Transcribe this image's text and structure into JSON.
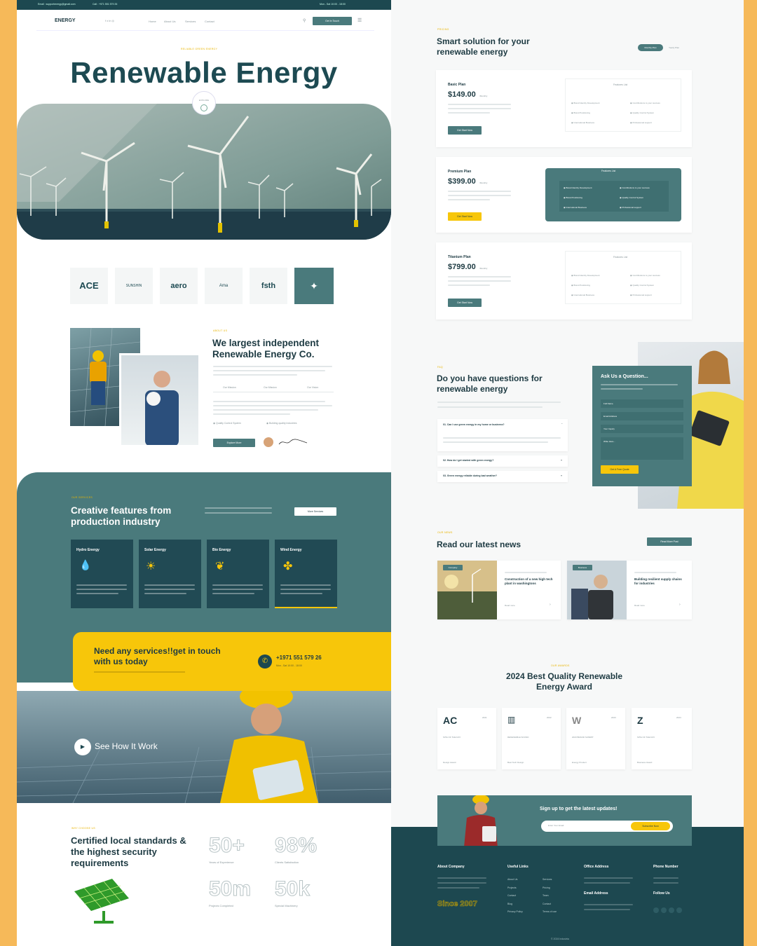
{
  "left": {
    "topbar": {
      "email": "Email : supportenergy@gmail.com",
      "call": "Call : +971 551 579 26",
      "hours": "Mon - Sat 10:00 - 18:00"
    },
    "nav": {
      "logo": "ENERGY",
      "links": [
        "Home",
        "About Us",
        "Services",
        "Contact"
      ],
      "cta": "Get In Touch"
    },
    "hero": {
      "kicker": "RELIABLE GREEN ENERGY",
      "title": "Renewable Energy",
      "badge": "EXPLORE"
    },
    "partners": [
      "ACE",
      "SUNSHIN",
      "aero",
      "Ama",
      "fsth",
      ""
    ],
    "about": {
      "kicker": "ABOUT US",
      "title": "We largest independent Renewable Energy Co.",
      "tabs": [
        "Our Mission",
        "Our Mission",
        "Our Vision"
      ],
      "checks": [
        "Quality Control System",
        "Building quality industries"
      ],
      "cta": "Explore More"
    },
    "features": {
      "kicker": "OUR SERVICES",
      "title": "Creative features from production industry",
      "cta": "More Services",
      "cards": [
        {
          "title": "Hydro Energy"
        },
        {
          "title": "Solar Energy"
        },
        {
          "title": "Bio Energy"
        },
        {
          "title": "Wind Energy"
        }
      ]
    },
    "contact": {
      "title": "Need any services!!get in touch with us today",
      "phone": "+1971 551 579 26",
      "hours": "Mon - Sat 10:00 - 18:00"
    },
    "video": {
      "label": "See How It Work"
    },
    "stats": {
      "kicker": "WHY CHOOSE US",
      "title": "Certified local standards & the highest security requirements",
      "items": [
        {
          "value": "50+",
          "label": "Years of Experience"
        },
        {
          "value": "98%",
          "label": "Clients Satisfaction"
        },
        {
          "value": "50m",
          "label": "Projects Completed"
        },
        {
          "value": "50k",
          "label": "Special Machinery"
        }
      ]
    }
  },
  "right": {
    "pricing": {
      "kicker": "PRICING",
      "title": "Smart solution for your renewable energy",
      "toggle": [
        "Monthly Plan",
        "Yearly Plan"
      ],
      "plans": [
        {
          "name": "Basic Plan",
          "price": "$149.00",
          "period": "/Monthly",
          "cta": "Get Start Now"
        },
        {
          "name": "Premium Plan",
          "price": "$399.00",
          "period": "/Monthly",
          "cta": "Get Start Now"
        },
        {
          "name": "Titanium Plan",
          "price": "$799.00",
          "period": "/Monthly",
          "cta": "Get Start Now"
        }
      ],
      "features_title": "Features List",
      "features": [
        "Brand Identity Development",
        "Contributions to your success",
        "Brand Positioning",
        "Quality Control System",
        "International Business",
        "Professional support"
      ]
    },
    "faq": {
      "kicker": "FAQ",
      "title": "Do you have questions for renewable energy",
      "q": [
        "01. Can I use green energy in my home or business?",
        "02. How do I get started with green energy?",
        "03. Green energy reliable during bad weather?"
      ],
      "form": {
        "title": "Ask Us a Question...",
        "fields": [
          "Full Name",
          "Email Address",
          "Your Inquiry",
          "Write Here..."
        ],
        "cta": "Get A Free Quote"
      }
    },
    "news": {
      "kicker": "OUR NEWS",
      "title": "Read our latest news",
      "cta": "Read More Post",
      "posts": [
        {
          "tag": "Company",
          "title": "Construction of a new high tech plant in washingtons",
          "more": "Read more"
        },
        {
          "tag": "Business",
          "title": "Building resilient supply chains for industries",
          "more": "Read more"
        }
      ]
    },
    "awards": {
      "kicker": "OUR AWARDS",
      "title": "2024 Best Quality Renewable Energy Award",
      "items": [
        {
          "year": "2021",
          "name": "SITE OF THE DAY",
          "foot": "Design Award"
        },
        {
          "year": "2022",
          "name": "RENEWABLE SOUND",
          "foot": "Best Tech Design"
        },
        {
          "year": "2023",
          "name": "2023 BRAND SUMMIT",
          "foot": "Energy Product"
        },
        {
          "year": "2024",
          "name": "SITE OF THE DAY",
          "foot": "Business Award"
        }
      ]
    },
    "newsletter": {
      "title": "Sign up to get the latest updates!",
      "placeholder": "Enter Your Email",
      "cta": "Subscribe Now"
    },
    "footer": {
      "cols": [
        "About Company",
        "Useful Links",
        "Office Address",
        "Phone Number"
      ],
      "links1": [
        "About Us",
        "Projects",
        "Contact",
        "Blog",
        "Privacy Policy"
      ],
      "links2": [
        "Services",
        "Pricing",
        "Team",
        "Contact",
        "Terms of use"
      ],
      "since": "Since 2007",
      "email_label": "Email Address",
      "follow": "Follow Us",
      "copy": "© 2024 Industria"
    }
  }
}
